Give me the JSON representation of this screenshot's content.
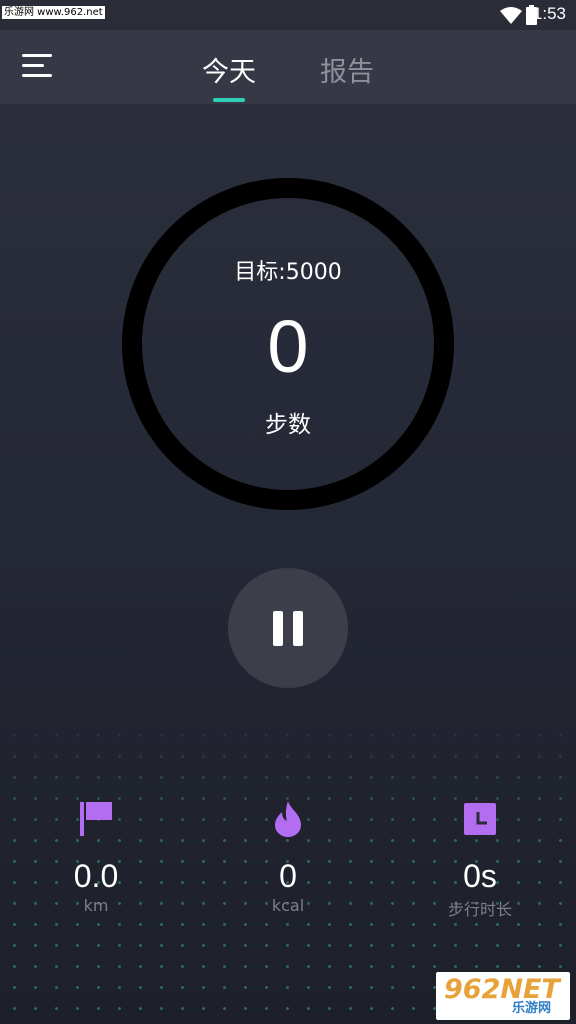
{
  "status_bar": {
    "watermark": "乐游网 www.962.net",
    "time": "1:53"
  },
  "header": {
    "tabs": [
      {
        "label": "今天",
        "active": true
      },
      {
        "label": "报告",
        "active": false
      }
    ],
    "accent_color": "#2fd0b5"
  },
  "ring": {
    "goal": "目标:5000",
    "steps": "0",
    "unit": "步数"
  },
  "controls": {
    "pause_icon": "pause-icon"
  },
  "stats": [
    {
      "icon": "flag-icon",
      "value": "0.0",
      "label": "km"
    },
    {
      "icon": "flame-icon",
      "value": "0",
      "label": "kcal"
    },
    {
      "icon": "clock-icon",
      "value": "0s",
      "label": "步行时长"
    }
  ],
  "stat_icon_color": "#b36df0",
  "watermark_br": {
    "big": "962NET",
    "small": "乐游网"
  }
}
